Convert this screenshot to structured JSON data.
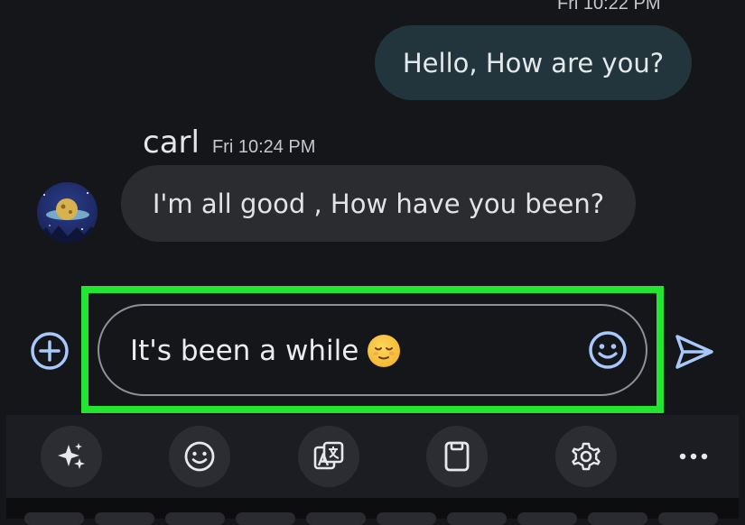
{
  "conversation": {
    "top_timestamp": "Fri 10:22 PM",
    "outgoing_message": "Hello, How are you?",
    "incoming": {
      "sender": "carl",
      "timestamp": "Fri 10:24 PM",
      "message": "I'm all good , How have you been?"
    }
  },
  "compose": {
    "text": "It's been a while"
  },
  "icons": {
    "add": "add-circle-icon",
    "emoji": "emoji-icon",
    "send": "send-icon",
    "toolbar": [
      "sparkle-icon",
      "emoji-icon",
      "translate-icon",
      "clipboard-icon",
      "settings-icon",
      "more-icon"
    ]
  },
  "colors": {
    "highlight": "#22e52f",
    "accent": "#a8c7fa",
    "outgoing_bubble": "#23353c",
    "incoming_bubble": "#2b2c30"
  }
}
